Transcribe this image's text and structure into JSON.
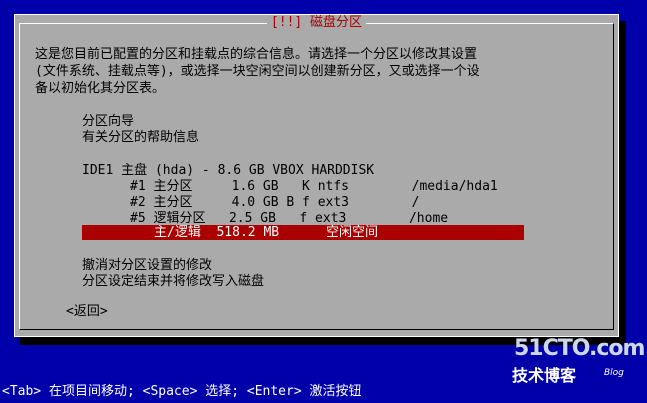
{
  "dialog": {
    "title": "[!!] 磁盘分区",
    "description": [
      "这是您目前已配置的分区和挂载点的综合信息。请选择一个分区以修改其设置",
      "(文件系统、挂载点等)，或选择一块空闲空间以创建新分区，又或选择一个设",
      "备以初始化其分区表。"
    ],
    "menu": {
      "guide": "分区向导",
      "help": "有关分区的帮助信息",
      "disk": "IDE1 主盘 (hda) - 8.6 GB VBOX HARDDISK",
      "partitions": [
        "#1 主分区     1.6 GB   K ntfs        /media/hda1",
        "#2 主分区     4.0 GB B f ext3        /",
        "#5 逻辑分区   2.5 GB   f ext3        /home"
      ],
      "free_space": "主/逻辑  518.2 MB      空闲空间",
      "undo": "撤消对分区设置的修改",
      "finish": "分区设定结束并将修改写入磁盘"
    },
    "back_button": "<返回>"
  },
  "status_bar": "<Tab> 在项目间移动; <Space> 选择; <Enter> 激活按钮",
  "watermark": {
    "site": "51CTO.com",
    "sub": "技术博客",
    "blog": "Blog"
  }
}
